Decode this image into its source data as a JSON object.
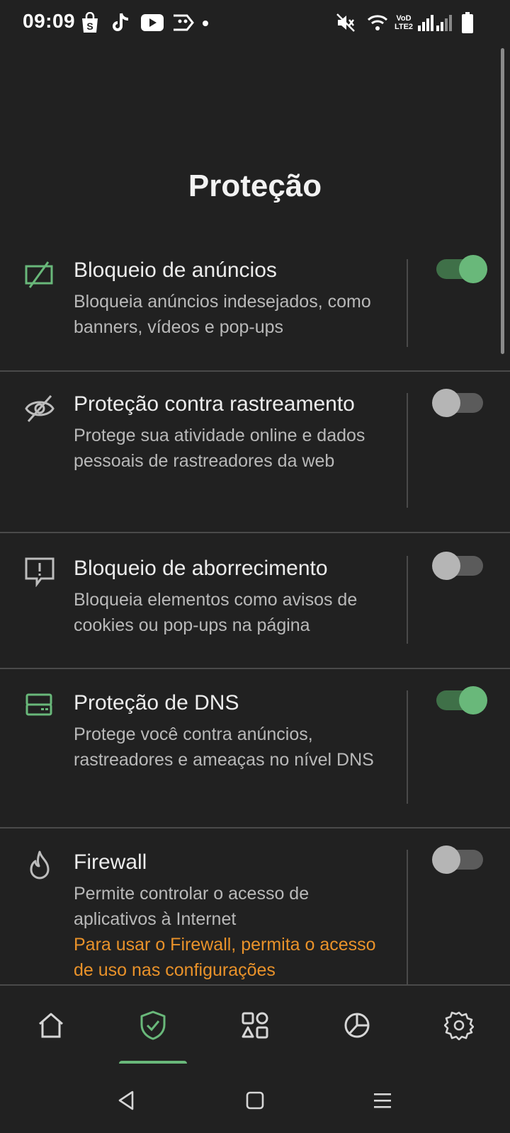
{
  "status_bar": {
    "time": "09:09",
    "left_icons": [
      "shopping-bag-icon",
      "tiktok-icon",
      "youtube-icon",
      "cast-icon",
      "dot-icon"
    ],
    "right_icons": [
      "mute-icon",
      "wifi-icon",
      "volte-icon",
      "signal-icon",
      "signal-icon",
      "battery-icon"
    ],
    "volte_text": "VoD LTE2"
  },
  "page": {
    "title": "Proteção"
  },
  "colors": {
    "accent": "#69b87a",
    "warning": "#e9922a",
    "background": "#212121"
  },
  "rows": [
    {
      "icon": "ad-block-icon",
      "title": "Bloqueio de anúncios",
      "description": "Bloqueia anúncios indesejados, como banners, vídeos e pop-ups",
      "enabled": true
    },
    {
      "icon": "eye-off-icon",
      "title": "Proteção contra rastreamento",
      "description": "Protege sua atividade online e dados pessoais de rastreadores da web",
      "enabled": false
    },
    {
      "icon": "alert-message-icon",
      "title": "Bloqueio de aborrecimento",
      "description": "Bloqueia elementos como avisos de cookies ou pop-ups na página",
      "enabled": false
    },
    {
      "icon": "dns-server-icon",
      "title": "Proteção de DNS",
      "description": "Protege você contra anúncios, rastreadores e ameaças no nível DNS",
      "enabled": true
    },
    {
      "icon": "flame-icon",
      "title": "Firewall",
      "description": "Permite controlar o acesso de aplicativos à Internet",
      "warning": "Para usar o Firewall, permita o acesso de uso nas configurações",
      "enabled": false
    }
  ],
  "bottom_nav": {
    "items": [
      "home-icon",
      "shield-check-icon",
      "apps-icon",
      "statistics-icon",
      "settings-icon"
    ],
    "selected_index": 1
  },
  "system_nav": [
    "back-icon",
    "home-square-icon",
    "menu-icon"
  ]
}
